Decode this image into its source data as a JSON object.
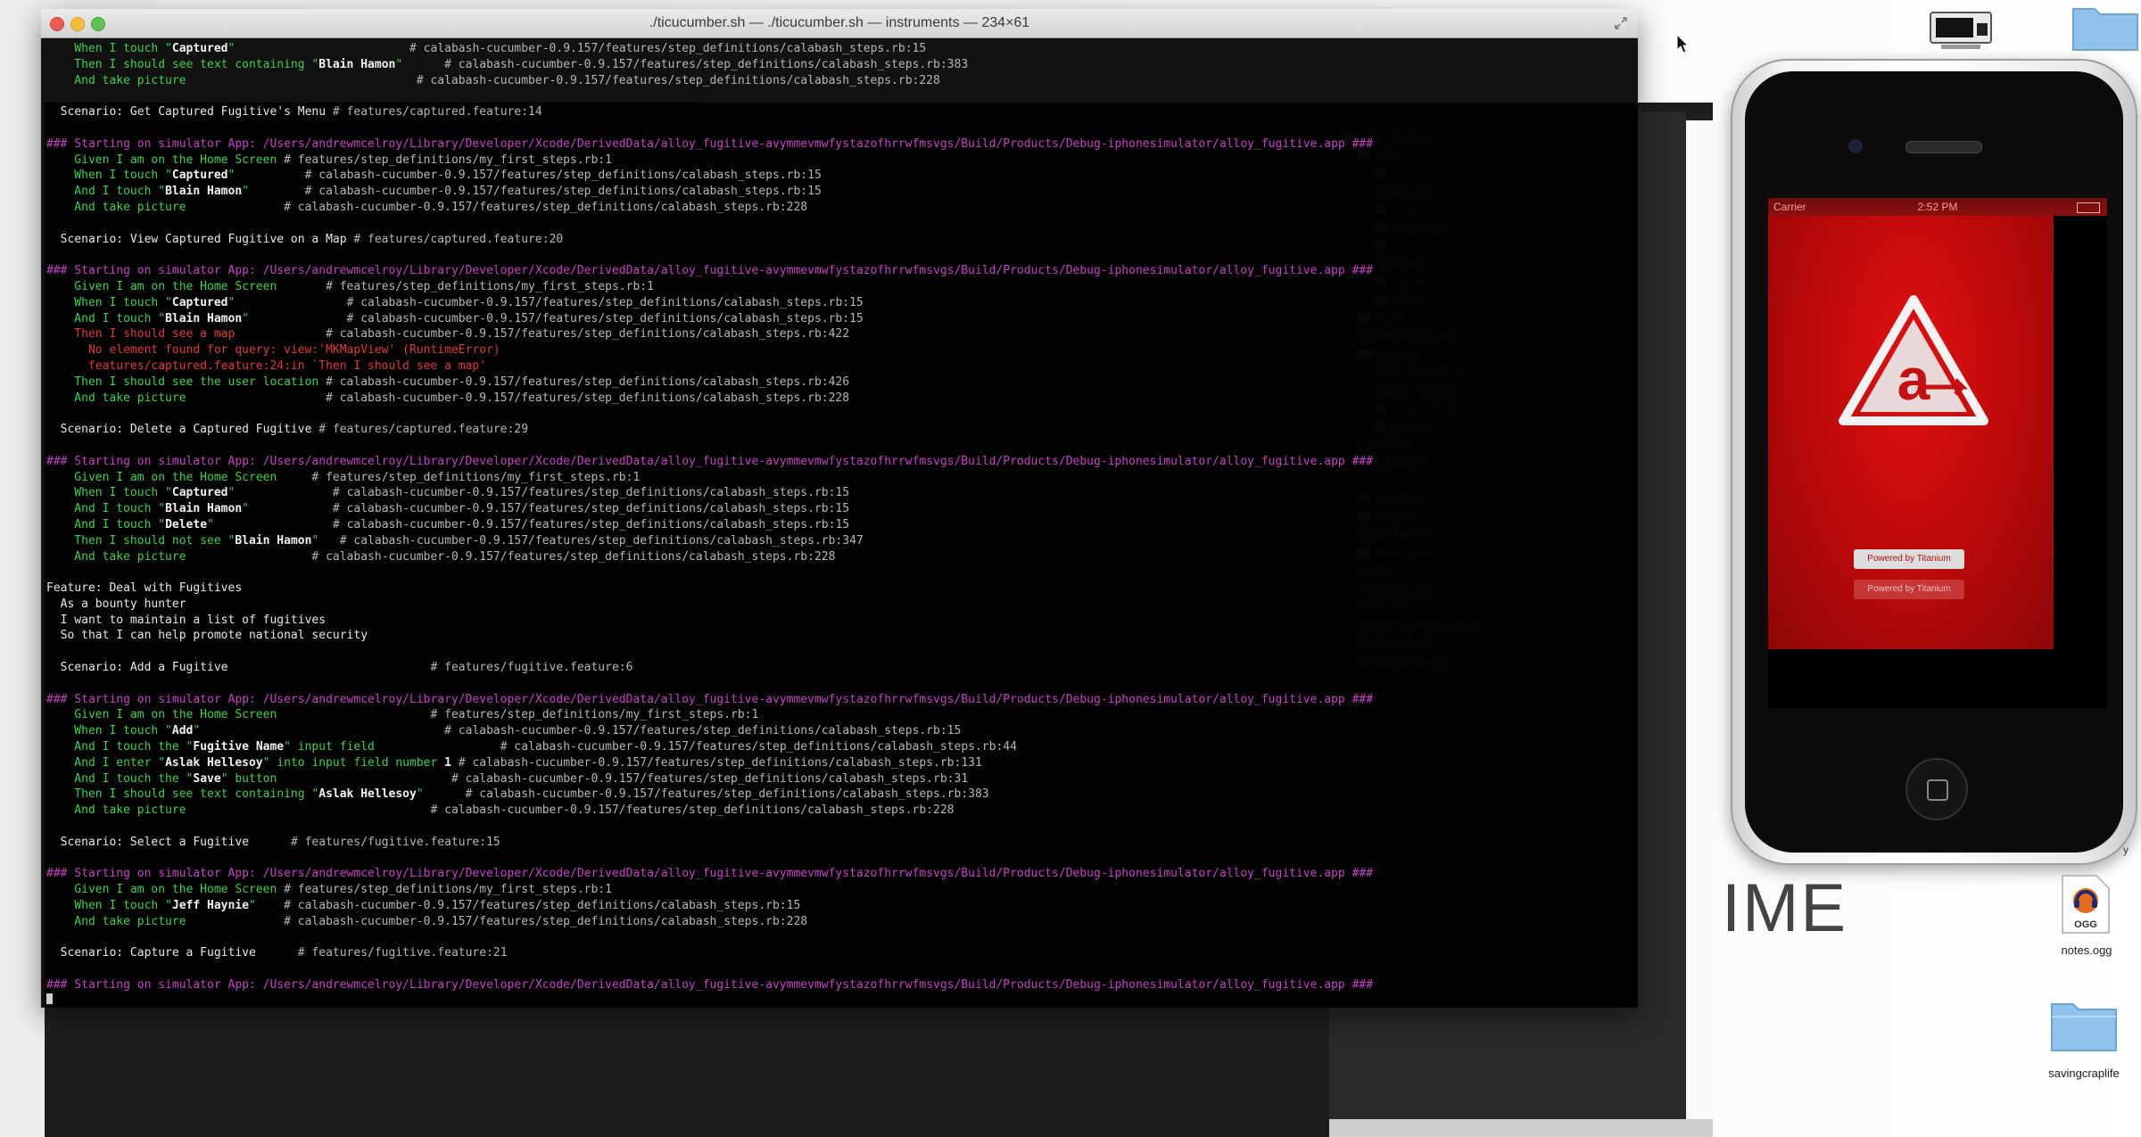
{
  "window": {
    "title": "./ticucumber.sh — ./ticucumber.sh — instruments — 234×61"
  },
  "colors": {
    "green": "#3fd04c",
    "magenta": "#c442c4",
    "red": "#e03a3a",
    "grey": "#b6b6b6",
    "splash_red": "#d10e0e"
  },
  "terminal_lines": [
    {
      "segments": [
        {
          "t": "    When I touch \"",
          "c": "green"
        },
        {
          "t": "Captured",
          "c": "hl"
        },
        {
          "t": "\"                         ",
          "c": "green"
        },
        {
          "t": "# calabash-cucumber-0.9.157/features/step_definitions/calabash_steps.rb:15",
          "c": "grey"
        }
      ]
    },
    {
      "segments": [
        {
          "t": "    Then I should see text containing \"",
          "c": "green"
        },
        {
          "t": "Blain Hamon",
          "c": "hl"
        },
        {
          "t": "\"      ",
          "c": "green"
        },
        {
          "t": "# calabash-cucumber-0.9.157/features/step_definitions/calabash_steps.rb:383",
          "c": "grey"
        }
      ]
    },
    {
      "segments": [
        {
          "t": "    And take picture                                 ",
          "c": "green"
        },
        {
          "t": "# calabash-cucumber-0.9.157/features/step_definitions/calabash_steps.rb:228",
          "c": "grey"
        }
      ]
    },
    {
      "segments": [
        {
          "t": "",
          "c": "white"
        }
      ]
    },
    {
      "segments": [
        {
          "t": "  Scenario: Get Captured Fugitive's Menu ",
          "c": "white"
        },
        {
          "t": "# features/captured.feature:14",
          "c": "grey"
        }
      ]
    },
    {
      "segments": [
        {
          "t": "",
          "c": "white"
        }
      ]
    },
    {
      "segments": [
        {
          "t": "### Starting on simulator App: /Users/andrewmcelroy/Library/Developer/Xcode/DerivedData/alloy_fugitive-avymmevmwfystazofhrrwfmsvgs/Build/Products/Debug-iphonesimulator/alloy_fugitive.app ###",
          "c": "magenta"
        }
      ]
    },
    {
      "segments": [
        {
          "t": "    Given I am on the Home Screen ",
          "c": "green"
        },
        {
          "t": "# features/step_definitions/my_first_steps.rb:1",
          "c": "grey"
        }
      ]
    },
    {
      "segments": [
        {
          "t": "    When I touch \"",
          "c": "green"
        },
        {
          "t": "Captured",
          "c": "hl"
        },
        {
          "t": "\"          ",
          "c": "green"
        },
        {
          "t": "# calabash-cucumber-0.9.157/features/step_definitions/calabash_steps.rb:15",
          "c": "grey"
        }
      ]
    },
    {
      "segments": [
        {
          "t": "    And I touch \"",
          "c": "green"
        },
        {
          "t": "Blain Hamon",
          "c": "hl"
        },
        {
          "t": "\"        ",
          "c": "green"
        },
        {
          "t": "# calabash-cucumber-0.9.157/features/step_definitions/calabash_steps.rb:15",
          "c": "grey"
        }
      ]
    },
    {
      "segments": [
        {
          "t": "    And take picture              ",
          "c": "green"
        },
        {
          "t": "# calabash-cucumber-0.9.157/features/step_definitions/calabash_steps.rb:228",
          "c": "grey"
        }
      ]
    },
    {
      "segments": [
        {
          "t": "",
          "c": "white"
        }
      ]
    },
    {
      "segments": [
        {
          "t": "  Scenario: View Captured Fugitive on a Map ",
          "c": "white"
        },
        {
          "t": "# features/captured.feature:20",
          "c": "grey"
        }
      ]
    },
    {
      "segments": [
        {
          "t": "",
          "c": "white"
        }
      ]
    },
    {
      "segments": [
        {
          "t": "### Starting on simulator App: /Users/andrewmcelroy/Library/Developer/Xcode/DerivedData/alloy_fugitive-avymmevmwfystazofhrrwfmsvgs/Build/Products/Debug-iphonesimulator/alloy_fugitive.app ###",
          "c": "magenta"
        }
      ]
    },
    {
      "segments": [
        {
          "t": "    Given I am on the Home Screen       ",
          "c": "green"
        },
        {
          "t": "# features/step_definitions/my_first_steps.rb:1",
          "c": "grey"
        }
      ]
    },
    {
      "segments": [
        {
          "t": "    When I touch \"",
          "c": "green"
        },
        {
          "t": "Captured",
          "c": "hl"
        },
        {
          "t": "\"                ",
          "c": "green"
        },
        {
          "t": "# calabash-cucumber-0.9.157/features/step_definitions/calabash_steps.rb:15",
          "c": "grey"
        }
      ]
    },
    {
      "segments": [
        {
          "t": "    And I touch \"",
          "c": "green"
        },
        {
          "t": "Blain Hamon",
          "c": "hl"
        },
        {
          "t": "\"              ",
          "c": "green"
        },
        {
          "t": "# calabash-cucumber-0.9.157/features/step_definitions/calabash_steps.rb:15",
          "c": "grey"
        }
      ]
    },
    {
      "segments": [
        {
          "t": "    Then I should see a map             ",
          "c": "red"
        },
        {
          "t": "# calabash-cucumber-0.9.157/features/step_definitions/calabash_steps.rb:422",
          "c": "grey"
        }
      ]
    },
    {
      "segments": [
        {
          "t": "      No element found for query: view:'MKMapView' (RuntimeError)",
          "c": "red"
        }
      ]
    },
    {
      "segments": [
        {
          "t": "      features/captured.feature:24:in `Then I should see a map'",
          "c": "red"
        }
      ]
    },
    {
      "segments": [
        {
          "t": "    Then I should see the user location ",
          "c": "green"
        },
        {
          "t": "# calabash-cucumber-0.9.157/features/step_definitions/calabash_steps.rb:426",
          "c": "grey"
        }
      ]
    },
    {
      "segments": [
        {
          "t": "    And take picture                    ",
          "c": "green"
        },
        {
          "t": "# calabash-cucumber-0.9.157/features/step_definitions/calabash_steps.rb:228",
          "c": "grey"
        }
      ]
    },
    {
      "segments": [
        {
          "t": "",
          "c": "white"
        }
      ]
    },
    {
      "segments": [
        {
          "t": "  Scenario: Delete a Captured Fugitive ",
          "c": "white"
        },
        {
          "t": "# features/captured.feature:29",
          "c": "grey"
        }
      ]
    },
    {
      "segments": [
        {
          "t": "",
          "c": "white"
        }
      ]
    },
    {
      "segments": [
        {
          "t": "### Starting on simulator App: /Users/andrewmcelroy/Library/Developer/Xcode/DerivedData/alloy_fugitive-avymmevmwfystazofhrrwfmsvgs/Build/Products/Debug-iphonesimulator/alloy_fugitive.app ###",
          "c": "magenta"
        }
      ]
    },
    {
      "segments": [
        {
          "t": "    Given I am on the Home Screen     ",
          "c": "green"
        },
        {
          "t": "# features/step_definitions/my_first_steps.rb:1",
          "c": "grey"
        }
      ]
    },
    {
      "segments": [
        {
          "t": "    When I touch \"",
          "c": "green"
        },
        {
          "t": "Captured",
          "c": "hl"
        },
        {
          "t": "\"              ",
          "c": "green"
        },
        {
          "t": "# calabash-cucumber-0.9.157/features/step_definitions/calabash_steps.rb:15",
          "c": "grey"
        }
      ]
    },
    {
      "segments": [
        {
          "t": "    And I touch \"",
          "c": "green"
        },
        {
          "t": "Blain Hamon",
          "c": "hl"
        },
        {
          "t": "\"            ",
          "c": "green"
        },
        {
          "t": "# calabash-cucumber-0.9.157/features/step_definitions/calabash_steps.rb:15",
          "c": "grey"
        }
      ]
    },
    {
      "segments": [
        {
          "t": "    And I touch \"",
          "c": "green"
        },
        {
          "t": "Delete",
          "c": "hl"
        },
        {
          "t": "\"                 ",
          "c": "green"
        },
        {
          "t": "# calabash-cucumber-0.9.157/features/step_definitions/calabash_steps.rb:15",
          "c": "grey"
        }
      ]
    },
    {
      "segments": [
        {
          "t": "    Then I should not see \"",
          "c": "green"
        },
        {
          "t": "Blain Hamon",
          "c": "hl"
        },
        {
          "t": "\"   ",
          "c": "green"
        },
        {
          "t": "# calabash-cucumber-0.9.157/features/step_definitions/calabash_steps.rb:347",
          "c": "grey"
        }
      ]
    },
    {
      "segments": [
        {
          "t": "    And take picture                  ",
          "c": "green"
        },
        {
          "t": "# calabash-cucumber-0.9.157/features/step_definitions/calabash_steps.rb:228",
          "c": "grey"
        }
      ]
    },
    {
      "segments": [
        {
          "t": "",
          "c": "white"
        }
      ]
    },
    {
      "segments": [
        {
          "t": "Feature: Deal with Fugitives",
          "c": "white"
        }
      ]
    },
    {
      "segments": [
        {
          "t": "  As a bounty hunter",
          "c": "white"
        }
      ]
    },
    {
      "segments": [
        {
          "t": "  I want to maintain a list of fugitives",
          "c": "white"
        }
      ]
    },
    {
      "segments": [
        {
          "t": "  So that I can help promote national security",
          "c": "white"
        }
      ]
    },
    {
      "segments": [
        {
          "t": "",
          "c": "white"
        }
      ]
    },
    {
      "segments": [
        {
          "t": "  Scenario: Add a Fugitive                             ",
          "c": "white"
        },
        {
          "t": "# features/fugitive.feature:6",
          "c": "grey"
        }
      ]
    },
    {
      "segments": [
        {
          "t": "",
          "c": "white"
        }
      ]
    },
    {
      "segments": [
        {
          "t": "### Starting on simulator App: /Users/andrewmcelroy/Library/Developer/Xcode/DerivedData/alloy_fugitive-avymmevmwfystazofhrrwfmsvgs/Build/Products/Debug-iphonesimulator/alloy_fugitive.app ###",
          "c": "magenta"
        }
      ]
    },
    {
      "segments": [
        {
          "t": "    Given I am on the Home Screen                      ",
          "c": "green"
        },
        {
          "t": "# features/step_definitions/my_first_steps.rb:1",
          "c": "grey"
        }
      ]
    },
    {
      "segments": [
        {
          "t": "    When I touch \"",
          "c": "green"
        },
        {
          "t": "Add",
          "c": "hl"
        },
        {
          "t": "\"                                   ",
          "c": "green"
        },
        {
          "t": "# calabash-cucumber-0.9.157/features/step_definitions/calabash_steps.rb:15",
          "c": "grey"
        }
      ]
    },
    {
      "segments": [
        {
          "t": "    And I touch the \"",
          "c": "green"
        },
        {
          "t": "Fugitive Name",
          "c": "hl"
        },
        {
          "t": "\" input field                  ",
          "c": "green"
        },
        {
          "t": "# calabash-cucumber-0.9.157/features/step_definitions/calabash_steps.rb:44",
          "c": "grey"
        }
      ]
    },
    {
      "segments": [
        {
          "t": "    And I enter \"",
          "c": "green"
        },
        {
          "t": "Aslak Hellesoy",
          "c": "hl"
        },
        {
          "t": "\" into input field number ",
          "c": "green"
        },
        {
          "t": "1",
          "c": "hl"
        },
        {
          "t": " ",
          "c": "green"
        },
        {
          "t": "# calabash-cucumber-0.9.157/features/step_definitions/calabash_steps.rb:131",
          "c": "grey"
        }
      ]
    },
    {
      "segments": [
        {
          "t": "    And I touch the \"",
          "c": "green"
        },
        {
          "t": "Save",
          "c": "hl"
        },
        {
          "t": "\" button                         ",
          "c": "green"
        },
        {
          "t": "# calabash-cucumber-0.9.157/features/step_definitions/calabash_steps.rb:31",
          "c": "grey"
        }
      ]
    },
    {
      "segments": [
        {
          "t": "    Then I should see text containing \"",
          "c": "green"
        },
        {
          "t": "Aslak Hellesoy",
          "c": "hl"
        },
        {
          "t": "\"      ",
          "c": "green"
        },
        {
          "t": "# calabash-cucumber-0.9.157/features/step_definitions/calabash_steps.rb:383",
          "c": "grey"
        }
      ]
    },
    {
      "segments": [
        {
          "t": "    And take picture                                   ",
          "c": "green"
        },
        {
          "t": "# calabash-cucumber-0.9.157/features/step_definitions/calabash_steps.rb:228",
          "c": "grey"
        }
      ]
    },
    {
      "segments": [
        {
          "t": "",
          "c": "white"
        }
      ]
    },
    {
      "segments": [
        {
          "t": "  Scenario: Select a Fugitive      ",
          "c": "white"
        },
        {
          "t": "# features/fugitive.feature:15",
          "c": "grey"
        }
      ]
    },
    {
      "segments": [
        {
          "t": "",
          "c": "white"
        }
      ]
    },
    {
      "segments": [
        {
          "t": "### Starting on simulator App: /Users/andrewmcelroy/Library/Developer/Xcode/DerivedData/alloy_fugitive-avymmevmwfystazofhrrwfmsvgs/Build/Products/Debug-iphonesimulator/alloy_fugitive.app ###",
          "c": "magenta"
        }
      ]
    },
    {
      "segments": [
        {
          "t": "    Given I am on the Home Screen ",
          "c": "green"
        },
        {
          "t": "# features/step_definitions/my_first_steps.rb:1",
          "c": "grey"
        }
      ]
    },
    {
      "segments": [
        {
          "t": "    When I touch \"",
          "c": "green"
        },
        {
          "t": "Jeff Haynie",
          "c": "hl"
        },
        {
          "t": "\"    ",
          "c": "green"
        },
        {
          "t": "# calabash-cucumber-0.9.157/features/step_definitions/calabash_steps.rb:15",
          "c": "grey"
        }
      ]
    },
    {
      "segments": [
        {
          "t": "    And take picture              ",
          "c": "green"
        },
        {
          "t": "# calabash-cucumber-0.9.157/features/step_definitions/calabash_steps.rb:228",
          "c": "grey"
        }
      ]
    },
    {
      "segments": [
        {
          "t": "",
          "c": "white"
        }
      ]
    },
    {
      "segments": [
        {
          "t": "  Scenario: Capture a Fugitive      ",
          "c": "white"
        },
        {
          "t": "# features/fugitive.feature:21",
          "c": "grey"
        }
      ]
    },
    {
      "segments": [
        {
          "t": "",
          "c": "white"
        }
      ]
    },
    {
      "segments": [
        {
          "t": "### Starting on simulator App: /Users/andrewmcelroy/Library/Developer/Xcode/DerivedData/alloy_fugitive-avymmevmwfystazofhrrwfmsvgs/Build/Products/Debug-iphonesimulator/alloy_fugitive.app ###",
          "c": "magenta"
        }
      ]
    }
  ],
  "project_tree": [
    {
      "label": "alloy_fugitive",
      "indent": 0,
      "folder": true
    },
    {
      "label": "app",
      "indent": 1,
      "folder": true
    },
    {
      "label": "assets",
      "indent": 2,
      "folder": true
    },
    {
      "label": "config.json",
      "indent": 2,
      "folder": false
    },
    {
      "label": "controllers",
      "indent": 2,
      "folder": true
    },
    {
      "label": "migrations",
      "indent": 2,
      "folder": true
    },
    {
      "label": "models",
      "indent": 2,
      "folder": true
    },
    {
      "label": "README",
      "indent": 2,
      "folder": false
    },
    {
      "label": "styles",
      "indent": 2,
      "folder": true
    },
    {
      "label": "views",
      "indent": 2,
      "folder": true
    },
    {
      "label": "build",
      "indent": 1,
      "folder": true
    },
    {
      "label": "CHANGELOG.txt",
      "indent": 1,
      "folder": false
    },
    {
      "label": "features",
      "indent": 1,
      "folder": true
    },
    {
      "label": "captured.feature",
      "indent": 2,
      "folder": false
    },
    {
      "label": "fugitive.feature",
      "indent": 2,
      "folder": false
    },
    {
      "label": "step_definitions",
      "indent": 2,
      "folder": true
    },
    {
      "label": "support",
      "indent": 2,
      "folder": true
    },
    {
      "label": "LICENSE",
      "indent": 1,
      "folder": false
    },
    {
      "label": "LICENSE.txt",
      "indent": 1,
      "folder": false
    },
    {
      "label": "manifest",
      "indent": 1,
      "folder": false
    },
    {
      "label": "modules",
      "indent": 1,
      "folder": true
    },
    {
      "label": "plugins",
      "indent": 1,
      "folder": true
    },
    {
      "label": "README.md",
      "indent": 1,
      "folder": false
    },
    {
      "label": "Resources",
      "indent": 1,
      "folder": true
    },
    {
      "label": "run.sh",
      "indent": 1,
      "folder": false
    },
    {
      "label": "runandroid.sh",
      "indent": 1,
      "folder": false
    },
    {
      "label": "tiapp.xml",
      "indent": 1,
      "folder": false
    },
    {
      "label": "ticucumber-android.sh",
      "indent": 1,
      "folder": false
    },
    {
      "label": "ticucumber.sh",
      "indent": 1,
      "folder": false
    },
    {
      "label": "twiticucumber.sh",
      "indent": 1,
      "folder": false
    }
  ],
  "simulator": {
    "carrier": "Carrier",
    "time": "2:52 PM",
    "powered_by_1": "Powered by Titanium",
    "powered_by_2": "Powered by Titanium"
  },
  "desktop": {
    "watermark": "IME",
    "ogg_badge": "OGG",
    "ogg_file_label": "notes.ogg",
    "folder_label": "savingcraplife",
    "edge_letter": "y"
  }
}
